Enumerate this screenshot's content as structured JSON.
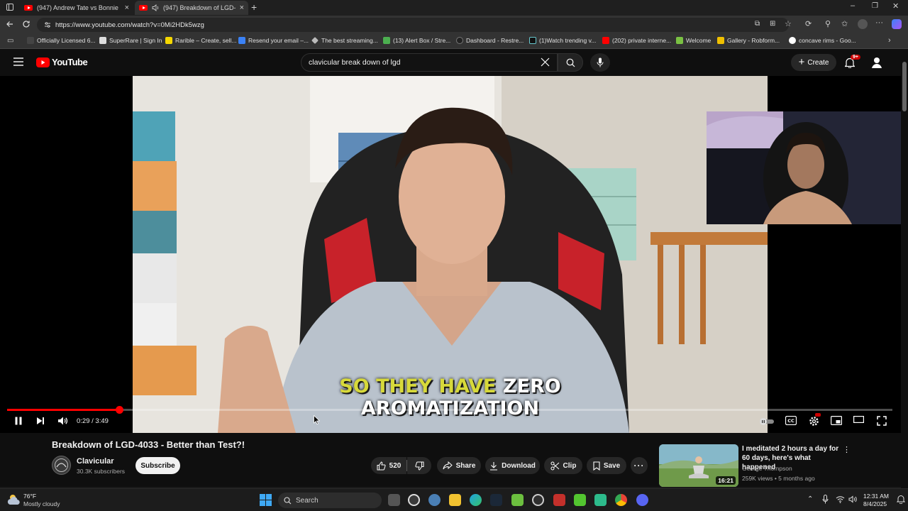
{
  "browser": {
    "tabs": [
      {
        "label": "(947) Andrew Tate vs Bonnie Blue"
      },
      {
        "label": "(947) Breakdown of LGD-403"
      }
    ],
    "url": "https://www.youtube.com/watch?v=0Mi2HDk5wzg",
    "bookmarks": [
      {
        "label": "Officially Licensed 6...",
        "color": "#444444"
      },
      {
        "label": "SuperRare | Sign In",
        "color": "#dddddd"
      },
      {
        "label": "Rarible – Create, sell...",
        "color": "#f5d700"
      },
      {
        "label": "Resend your email –...",
        "color": "#3b82f6"
      },
      {
        "label": "The best streaming...",
        "color": "#bbbbbb"
      },
      {
        "label": "(13) Alert Box / Stre...",
        "color": "#4caf50"
      },
      {
        "label": "Dashboard - Restre...",
        "color": "#222222"
      },
      {
        "label": "(1)Watch trending v...",
        "color": "#111111"
      },
      {
        "label": "(202) private interne...",
        "color": "#ff0000"
      },
      {
        "label": "Welcome",
        "color": "#7ac143"
      },
      {
        "label": "Gallery - Robform...",
        "color": "#f0c000"
      },
      {
        "label": "concave rims - Goo...",
        "color": "#ffffff"
      }
    ]
  },
  "youtube": {
    "logo_text": "YouTube",
    "search_value": "clavicular break down of lgd",
    "create_label": "Create",
    "notification_count": "9+"
  },
  "player": {
    "caption_highlight": "SO THEY HAVE",
    "caption_rest_line1": "ZERO",
    "caption_line2": "AROMATIZATION",
    "time_display": "0:29 / 3:49",
    "progress_fraction": 0.127
  },
  "video": {
    "title": "Breakdown of LGD-4033 - Better than Test?!",
    "channel": "Clavicular",
    "subscribers": "30.3K subscribers",
    "subscribe_label": "Subscribe",
    "likes": "520",
    "share_label": "Share",
    "download_label": "Download",
    "clip_label": "Clip",
    "save_label": "Save"
  },
  "recommendation": {
    "title": "I meditated 2 hours a day for 60 days, here's what happened",
    "channel": "George Thompson",
    "meta": "259K views • 5 months ago",
    "duration": "16:21"
  },
  "taskbar": {
    "weather_temp": "76°F",
    "weather_desc": "Mostly cloudy",
    "search_label": "Search",
    "time": "12:31 AM",
    "date": "8/4/2025"
  }
}
